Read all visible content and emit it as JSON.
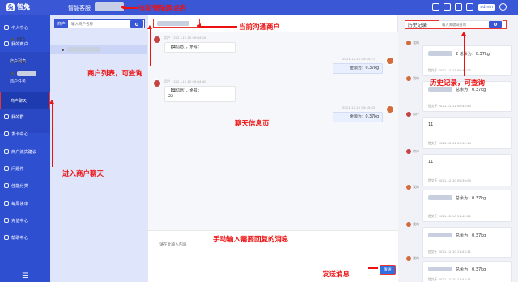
{
  "brand": {
    "name": "智兔",
    "app_name": "智能客服"
  },
  "colors": {
    "primary": "#3a57d6",
    "nav": "#2f4fd1",
    "annotation": "#e11111"
  },
  "nav": {
    "items": [
      {
        "label": "个人中心",
        "icon": "user-icon"
      },
      {
        "label": "我的商户",
        "icon": "store-icon"
      }
    ],
    "sub_items": [
      {
        "label": "商户列表"
      },
      {
        "label": "商户任务"
      },
      {
        "label": "商户聊天",
        "active": true
      }
    ],
    "more_items": [
      {
        "label": "我的群",
        "icon": "group-icon"
      },
      {
        "label": "发卡中心",
        "icon": "send-icon"
      },
      {
        "label": "商户流失建议",
        "icon": "chart-icon"
      },
      {
        "label": "问题件",
        "icon": "question-icon"
      },
      {
        "label": "佳能分类",
        "icon": "tag-icon"
      },
      {
        "label": "每周读本",
        "icon": "book-icon"
      },
      {
        "label": "充值中心",
        "icon": "wallet-icon"
      },
      {
        "label": "帮助中心",
        "icon": "help-icon"
      }
    ],
    "menu_glyph": "☰"
  },
  "topbar": {
    "user_badge": "admin"
  },
  "merchant_list": {
    "search_label": "商户",
    "search_placeholder": "输入商户名称",
    "items": [
      {
        "label": "666"
      },
      {
        "label": ""
      },
      {
        "label": "未知"
      }
    ]
  },
  "chat": {
    "messages": [
      {
        "side": "left",
        "meta": "用户 · 2021-12-10 09:44:16",
        "lines": [
          "【集信息】，余号："
        ]
      },
      {
        "side": "right",
        "meta": "2021-12-10 09:44:27",
        "lines": [
          "金额为：0.37kg"
        ]
      },
      {
        "side": "left",
        "meta": "用户 · 2021-12-10 09:44:40",
        "lines": [
          "【集信息】，余号：",
          "22"
        ]
      },
      {
        "side": "right",
        "meta": "2021-12-10 09:45:02",
        "lines": [
          "金额为：0.37kg"
        ]
      }
    ],
    "composer_placeholder": "请在此输入内容",
    "send_label": "发送"
  },
  "history": {
    "title": "历史记录",
    "search_placeholder": "输入关键词查询",
    "cards": [
      {
        "who": "我的",
        "line": "2 总余为：0.37kg",
        "time": "提交于 2021-12-11 09:44:27"
      },
      {
        "who": "我的",
        "line": "总余为：0.37kg",
        "time": "提交于 2021-12-11 09:43:43"
      },
      {
        "who": "商户",
        "line": "11",
        "time": "提交于 2021-12-11 09:39:14",
        "merchant": true
      },
      {
        "who": "商户",
        "line": "11",
        "time": "提交于 2021-12-10 09:39:09",
        "merchant": true
      },
      {
        "who": "我的",
        "line": "总余为：0.37kg",
        "time": "提交于 2021-12-10 11:43:21"
      },
      {
        "who": "我的",
        "line": "总余为：0.37kg",
        "time": "提交于 2021-12-10 11:43:11"
      },
      {
        "who": "我的",
        "line": "总余为：0.37kg",
        "time": "提交于 2021-12-10 11:43:11"
      }
    ]
  },
  "annotations": {
    "site_name": "当前登陆网点名",
    "current_merchant": "当前沟通商户",
    "merchant_list": "商户列表，可查询",
    "chat_info": "聊天信息页",
    "history": "历史记录，可查询",
    "enter_chat": "进入商户聊天",
    "manual_input": "手动输入需要回复的消息",
    "send": "发送消息"
  }
}
